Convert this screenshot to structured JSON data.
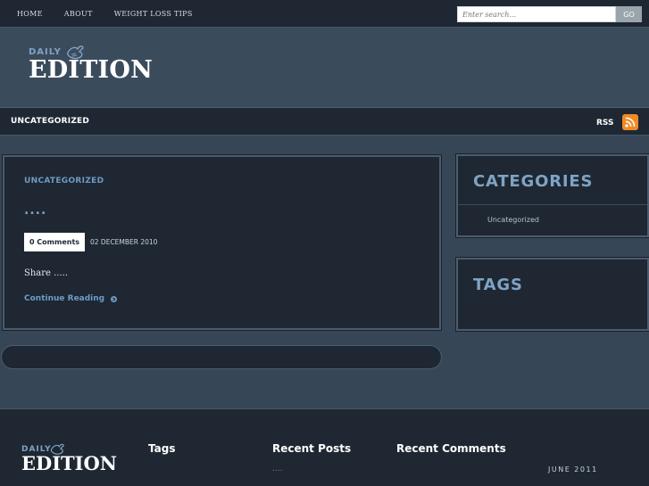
{
  "nav": {
    "items": [
      "HOME",
      "ABOUT",
      "WEIGHT LOSS TIPS"
    ]
  },
  "search": {
    "placeholder": "Enter search...",
    "button_label": "GO"
  },
  "logo": {
    "daily": "DAILY",
    "edition": "EDITION"
  },
  "breadcrumb": {
    "label": "UNCATEGORIZED",
    "rss_label": "RSS"
  },
  "post": {
    "category": "UNCATEGORIZED",
    "title": "....",
    "comments_label": "0 Comments",
    "date": "02 DECEMBER 2010",
    "excerpt": "Share .....",
    "continue_label": "Continue Reading"
  },
  "sidebar": {
    "categories_title": "CATEGORIES",
    "categories_items": [
      "Uncategorized"
    ],
    "tags_title": "TAGS"
  },
  "footer": {
    "tags_heading": "Tags",
    "recent_posts_heading": "Recent Posts",
    "recent_posts_item": "....",
    "recent_comments_heading": "Recent Comments",
    "archive_month": "JUNE 2011"
  },
  "colors": {
    "accent": "#7fa3c4",
    "dark": "#1e2732",
    "body": "#364656",
    "rss": "#f08a24"
  }
}
